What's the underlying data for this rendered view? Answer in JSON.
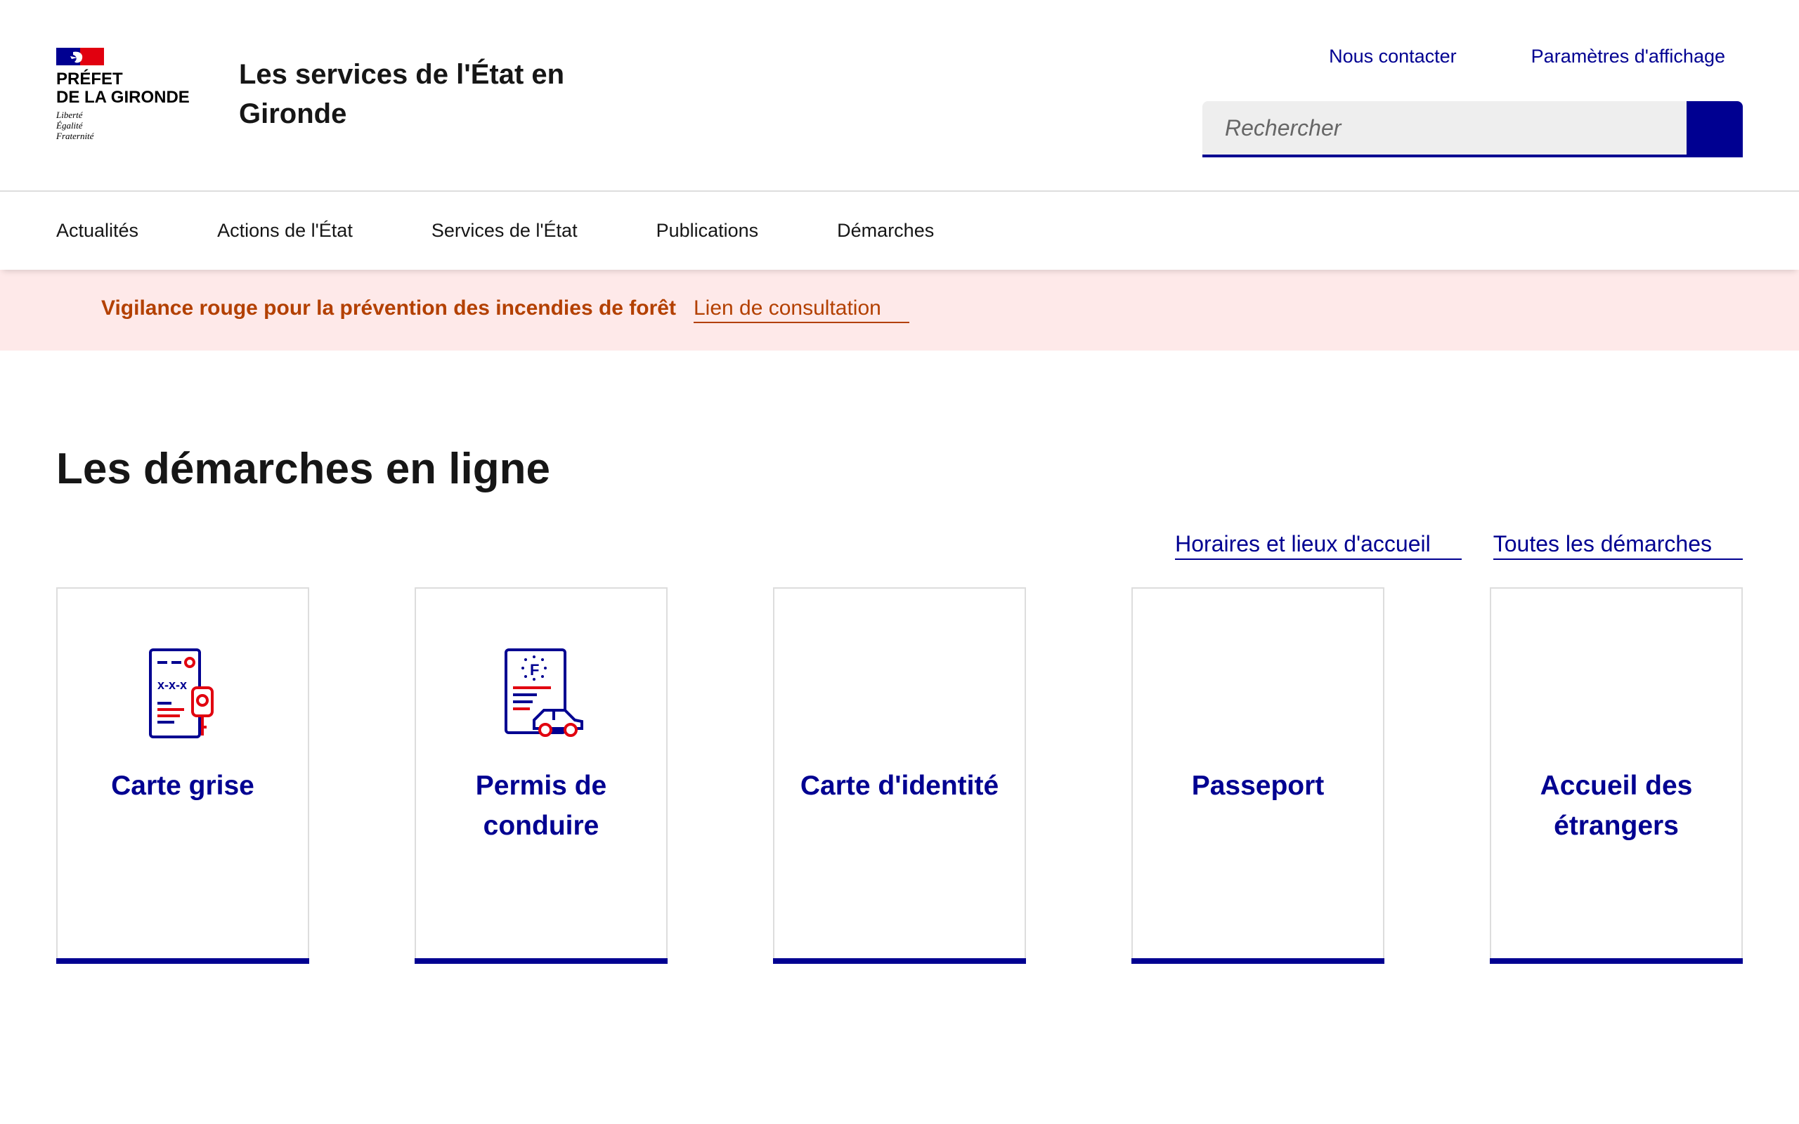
{
  "header": {
    "prefet_name": "PRÉFET\nDE LA GIRONDE",
    "devise": "Liberté\nÉgalité\nFraternité",
    "service_title": "Les services de l'État en Gironde",
    "links": [
      "Nous contacter",
      "Paramètres d'affichage"
    ],
    "search": {
      "placeholder": "Rechercher"
    }
  },
  "nav": {
    "items": [
      "Actualités",
      "Actions de l'État",
      "Services de l'État",
      "Publications",
      "Démarches"
    ]
  },
  "alert": {
    "title": "Vigilance rouge pour la prévention des incendies de forêt",
    "link": "Lien de consultation"
  },
  "main": {
    "title": "Les démarches en ligne",
    "links": [
      "Horaires et lieux d'accueil",
      "Toutes les démarches"
    ],
    "tiles": [
      {
        "title": "Carte grise",
        "icon": "vehicle-registration-icon"
      },
      {
        "title": "Permis de conduire",
        "icon": "driving-licence-icon"
      },
      {
        "title": "Carte d'identité",
        "icon": ""
      },
      {
        "title": "Passeport",
        "icon": ""
      },
      {
        "title": "Accueil des étrangers",
        "icon": ""
      }
    ]
  },
  "colors": {
    "blue_france": "#000091",
    "red_marianne": "#e1000f",
    "alert_bg": "#fee9e9",
    "alert_text": "#b34000"
  }
}
